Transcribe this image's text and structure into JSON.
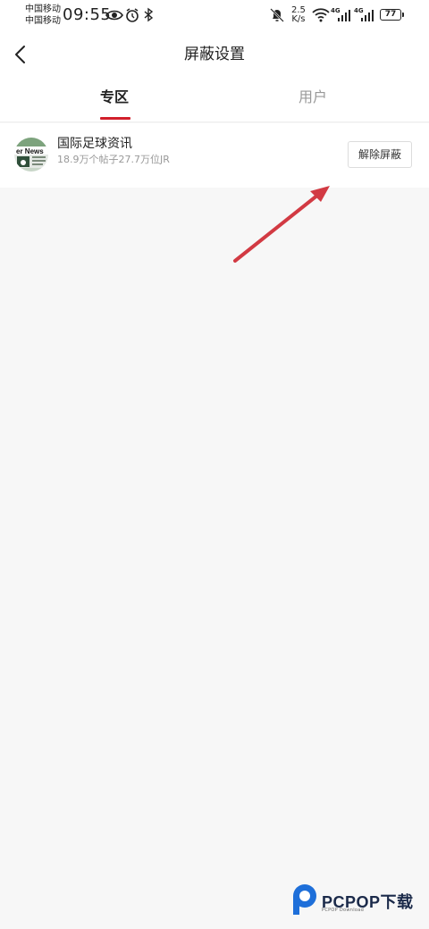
{
  "status_bar": {
    "carrier_1": "中国移动",
    "carrier_2": "中国移动",
    "time": "09:55",
    "speed_value": "2.5",
    "speed_unit": "K/s",
    "network_1": "4G",
    "network_2": "4G",
    "battery": "77"
  },
  "header": {
    "title": "屏蔽设置"
  },
  "tabs": [
    {
      "label": "专区",
      "active": true
    },
    {
      "label": "用户",
      "active": false
    }
  ],
  "blocked_items": [
    {
      "thumbnail_text": "er News",
      "name": "国际足球资讯",
      "meta": "18.9万个帖子27.7万位JR",
      "action": "解除屏蔽"
    }
  ],
  "watermark": {
    "brand": "PCPOP下载",
    "sub": "PCPOP Download"
  },
  "colors": {
    "accent": "#d21f2b",
    "arrow": "#d23a43"
  }
}
